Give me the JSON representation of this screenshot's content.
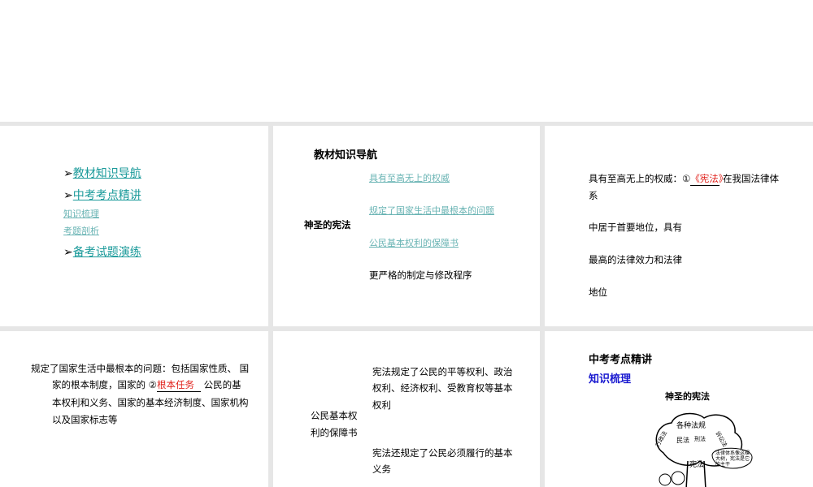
{
  "slide1": {
    "nav": [
      {
        "label": "教材知识导航"
      },
      {
        "label": "中考考点精讲"
      },
      {
        "label": "知识梳理"
      },
      {
        "label": "考题剖析"
      },
      {
        "label": "备考试题演练"
      }
    ]
  },
  "slide2": {
    "title": "教材知识导航",
    "center": "神圣的宪法",
    "branches": [
      "具有至高无上的权威",
      "规定了国家生活中最根本的问题",
      "公民基本权利的保障书",
      "更严格的制定与修改程序"
    ]
  },
  "slide3": {
    "line1_pre": "具有至高无上的权威：①",
    "answer1": "《宪法》",
    "line1_post": "在我国法律体",
    "line2": "系",
    "line3": "中居于首要地位，具有",
    "line4": "最高的法律效力和法律",
    "line5": "地位"
  },
  "slide4": {
    "line1": "规定了国家生活中最根本的问题：包括国家性质、 国",
    "line2_pre": "家的根本制度，国家的 ②",
    "answer2": "根本任务",
    "line2_post": "公民的基",
    "line3": "本权利和义务、国家的基本经济制度、国家机构",
    "line4": "以及国家标志等"
  },
  "slide5": {
    "left1": "公民基本权",
    "left2": "利的保障书",
    "r1": "宪法规定了公民的平等权利、政治",
    "r2": "权利、经济权利、受教育权等基本",
    "r3": "权利",
    "r4": "宪法还规定了公民必须履行的基本",
    "r5": "义务"
  },
  "slide6": {
    "heading": "中考考点精讲",
    "subheading": "知识梳理",
    "caption": "神圣的宪法",
    "tree_words": [
      "各种法规",
      "行政法",
      "民法",
      "刑法",
      "诉讼法",
      "宪法",
      "法律体系像这棵大树，宪法是它的主干"
    ]
  }
}
